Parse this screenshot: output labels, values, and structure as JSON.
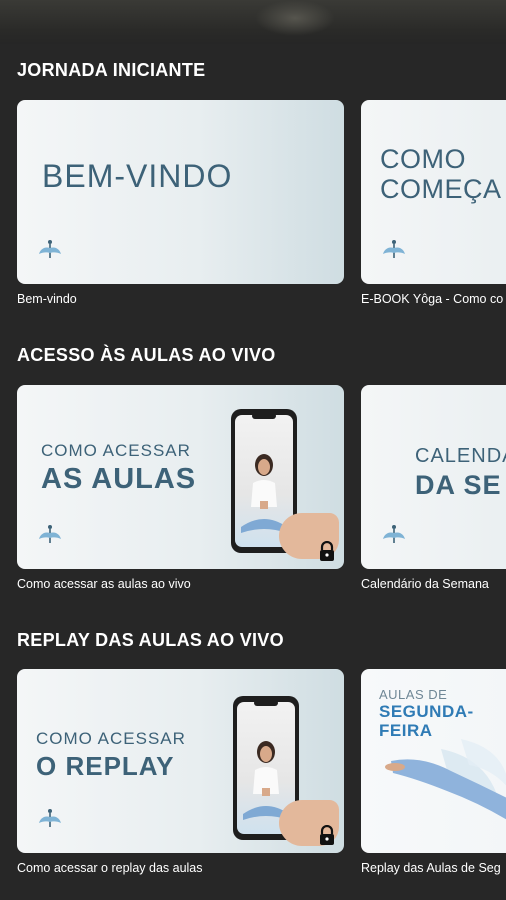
{
  "sections": [
    {
      "title": "JORNADA INICIANTE",
      "cards": [
        {
          "thumb_lines": [
            "BEM-VINDO"
          ],
          "caption": "Bem-vindo"
        },
        {
          "thumb_lines": [
            "COMO",
            "COMEÇA"
          ],
          "caption": "E-BOOK Yôga - Como co"
        }
      ]
    },
    {
      "title": "ACESSO ÀS AULAS AO VIVO",
      "cards": [
        {
          "thumb_lines": [
            "COMO ACESSAR",
            "AS AULAS"
          ],
          "caption": "Como acessar as aulas ao vivo",
          "locked": true
        },
        {
          "thumb_lines": [
            "CALENDÁ",
            "DA SE"
          ],
          "caption": "Calendário da Semana"
        }
      ]
    },
    {
      "title": "REPLAY DAS AULAS AO VIVO",
      "cards": [
        {
          "thumb_lines": [
            "COMO ACESSAR",
            "O REPLAY"
          ],
          "caption": "Como acessar o replay das aulas",
          "locked": true
        },
        {
          "thumb_lines": [
            "AULAS DE",
            "SEGUNDA-",
            "FEIRA"
          ],
          "caption": "Replay das Aulas de Seg"
        }
      ]
    }
  ],
  "icons": {
    "brand_logo": "yoga-lotus-logo-icon",
    "locked": "lock-icon"
  },
  "colors": {
    "background": "#272727",
    "thumb_text": "#3d6278",
    "accent_blue": "#2f7bb5"
  }
}
